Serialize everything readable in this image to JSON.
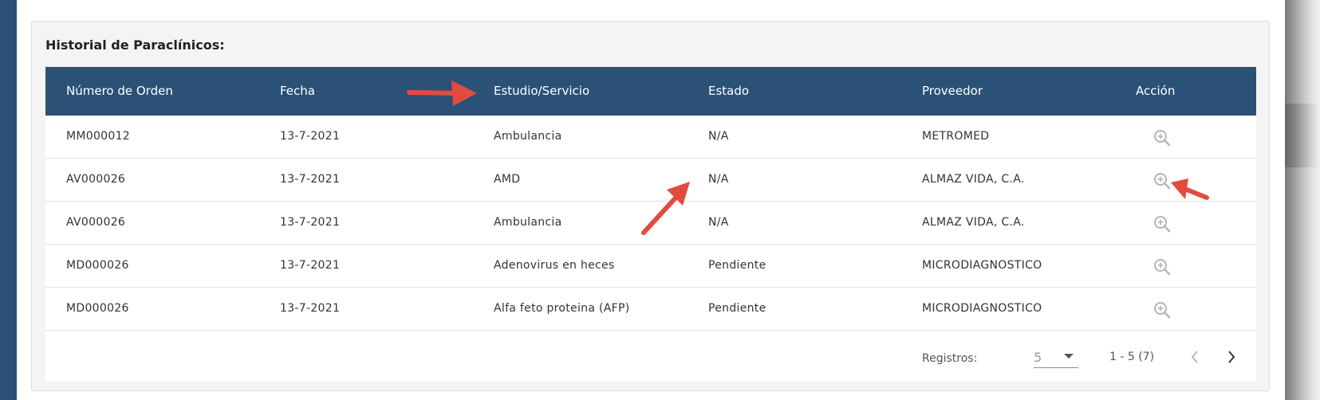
{
  "card": {
    "title": "Historial de Paraclínicos:"
  },
  "table": {
    "headers": [
      "Número de Orden",
      "Fecha",
      "Estudio/Servicio",
      "Estado",
      "Proveedor",
      "Acción"
    ],
    "rows": [
      {
        "orden": "MM000012",
        "fecha": "13-7-2021",
        "estudio": "Ambulancia",
        "estado": "N/A",
        "proveedor": "METROMED"
      },
      {
        "orden": "AV000026",
        "fecha": "13-7-2021",
        "estudio": "AMD",
        "estado": "N/A",
        "proveedor": "ALMAZ VIDA, C.A."
      },
      {
        "orden": "AV000026",
        "fecha": "13-7-2021",
        "estudio": "Ambulancia",
        "estado": "N/A",
        "proveedor": "ALMAZ VIDA, C.A."
      },
      {
        "orden": "MD000026",
        "fecha": "13-7-2021",
        "estudio": "Adenovirus en heces",
        "estado": "Pendiente",
        "proveedor": "MICRODIAGNOSTICO"
      },
      {
        "orden": "MD000026",
        "fecha": "13-7-2021",
        "estudio": "Alfa feto proteina (AFP)",
        "estado": "Pendiente",
        "proveedor": "MICRODIAGNOSTICO"
      }
    ],
    "action_icon": "zoom-in-icon"
  },
  "footer": {
    "registros_label": "Registros:",
    "registros_value": "5",
    "range_text": "1 - 5 (7)",
    "prev_icon": "chevron-left-icon",
    "next_icon": "chevron-right-icon"
  },
  "colors": {
    "header_bg": "#2c5177",
    "sidebar": "#2b5179",
    "annotation_arrow": "#e34b3f"
  }
}
